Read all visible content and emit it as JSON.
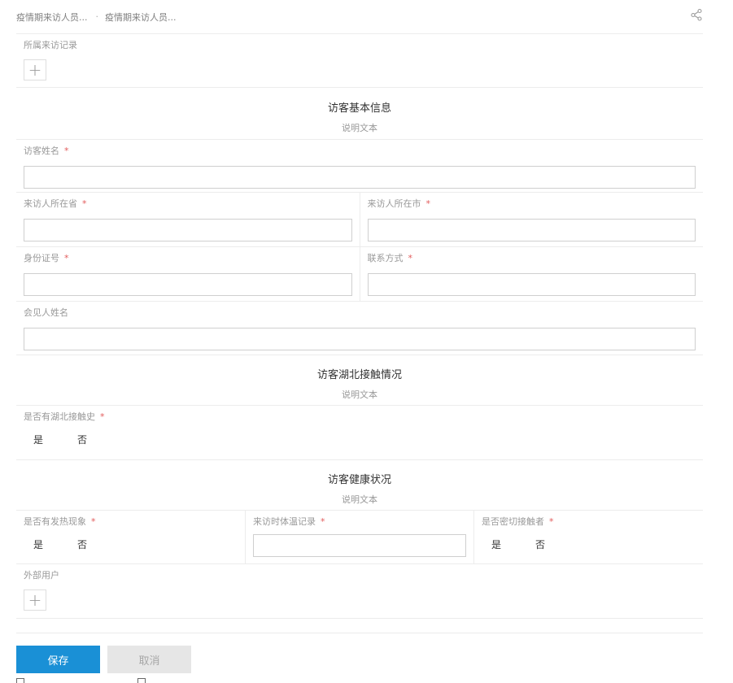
{
  "breadcrumb": {
    "items": [
      "疫情期来访人员...",
      "疫情期来访人员..."
    ],
    "separator": "·"
  },
  "form": {
    "visit_record": {
      "label": "所属来访记录",
      "add_icon": "plus-icon"
    },
    "section_basic": {
      "title": "访客基本信息",
      "subtitle": "说明文本"
    },
    "visitor_name": {
      "label": "访客姓名",
      "required": "*",
      "value": ""
    },
    "province": {
      "label": "来访人所在省",
      "required": "*",
      "value": ""
    },
    "city": {
      "label": "来访人所在市",
      "required": "*",
      "value": ""
    },
    "id_number": {
      "label": "身份证号",
      "required": "*",
      "value": ""
    },
    "contact": {
      "label": "联系方式",
      "required": "*",
      "value": ""
    },
    "host_name": {
      "label": "会见人姓名",
      "value": ""
    },
    "section_hubei": {
      "title": "访客湖北接触情况",
      "subtitle": "说明文本"
    },
    "hubei_contact": {
      "label": "是否有湖北接触史",
      "required": "*",
      "options": [
        "是",
        "否"
      ]
    },
    "section_health": {
      "title": "访客健康状况",
      "subtitle": "说明文本"
    },
    "fever": {
      "label": "是否有发热现象",
      "required": "*",
      "options": [
        "是",
        "否"
      ]
    },
    "temperature": {
      "label": "来访时体温记录",
      "required": "*",
      "value": ""
    },
    "close_contact": {
      "label": "是否密切接触者",
      "required": "*",
      "options": [
        "是",
        "否"
      ]
    },
    "external_user": {
      "label": "外部用户",
      "add_icon": "plus-icon"
    }
  },
  "actions": {
    "save_label": "保存",
    "cancel_label": "取消"
  },
  "colors": {
    "primary": "#1a90d6",
    "required": "#e25b5b",
    "border": "#ececec"
  }
}
